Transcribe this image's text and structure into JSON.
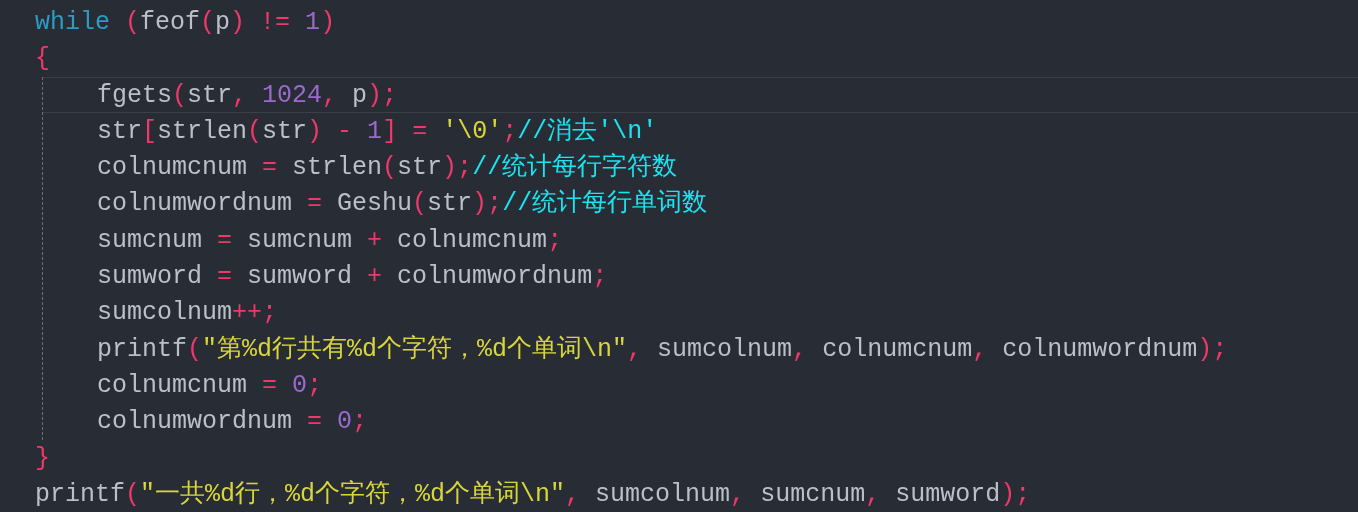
{
  "lines": [
    {
      "current": false,
      "tokens": [
        {
          "kind": "keyword",
          "text": "while"
        },
        {
          "kind": "operator",
          "text": " ("
        },
        {
          "kind": "identifier",
          "text": "feof"
        },
        {
          "kind": "operator",
          "text": "("
        },
        {
          "kind": "identifier",
          "text": "p"
        },
        {
          "kind": "operator",
          "text": ")"
        },
        {
          "kind": "operator",
          "text": " !="
        },
        {
          "kind": "number",
          "text": " 1"
        },
        {
          "kind": "operator",
          "text": ")"
        }
      ]
    },
    {
      "current": false,
      "tokens": [
        {
          "kind": "operator",
          "text": "{"
        }
      ],
      "children": [
        {
          "current": true,
          "tokens": [
            {
              "kind": "identifier",
              "text": "fgets"
            },
            {
              "kind": "operator",
              "text": "("
            },
            {
              "kind": "identifier",
              "text": "str"
            },
            {
              "kind": "operator",
              "text": ","
            },
            {
              "kind": "number",
              "text": " 1024"
            },
            {
              "kind": "operator",
              "text": ","
            },
            {
              "kind": "identifier",
              "text": " p"
            },
            {
              "kind": "operator",
              "text": ");"
            }
          ]
        },
        {
          "current": false,
          "tokens": [
            {
              "kind": "identifier",
              "text": "str"
            },
            {
              "kind": "operator",
              "text": "["
            },
            {
              "kind": "identifier",
              "text": "strlen"
            },
            {
              "kind": "operator",
              "text": "("
            },
            {
              "kind": "identifier",
              "text": "str"
            },
            {
              "kind": "operator",
              "text": ")"
            },
            {
              "kind": "operator",
              "text": " -"
            },
            {
              "kind": "number",
              "text": " 1"
            },
            {
              "kind": "operator",
              "text": "]"
            },
            {
              "kind": "operator",
              "text": " ="
            },
            {
              "kind": "string",
              "text": " '\\0'"
            },
            {
              "kind": "operator",
              "text": ";"
            },
            {
              "kind": "comment",
              "text": "//消去'\\n'"
            }
          ]
        },
        {
          "current": false,
          "tokens": [
            {
              "kind": "identifier",
              "text": "colnumcnum"
            },
            {
              "kind": "operator",
              "text": " ="
            },
            {
              "kind": "identifier",
              "text": " strlen"
            },
            {
              "kind": "operator",
              "text": "("
            },
            {
              "kind": "identifier",
              "text": "str"
            },
            {
              "kind": "operator",
              "text": ");"
            },
            {
              "kind": "comment",
              "text": "//统计每行字符数"
            }
          ]
        },
        {
          "current": false,
          "tokens": [
            {
              "kind": "identifier",
              "text": "colnumwordnum"
            },
            {
              "kind": "operator",
              "text": " ="
            },
            {
              "kind": "identifier",
              "text": " Geshu"
            },
            {
              "kind": "operator",
              "text": "("
            },
            {
              "kind": "identifier",
              "text": "str"
            },
            {
              "kind": "operator",
              "text": ");"
            },
            {
              "kind": "comment",
              "text": "//统计每行单词数"
            }
          ]
        },
        {
          "current": false,
          "tokens": [
            {
              "kind": "identifier",
              "text": "sumcnum"
            },
            {
              "kind": "operator",
              "text": " ="
            },
            {
              "kind": "identifier",
              "text": " sumcnum"
            },
            {
              "kind": "operator",
              "text": " +"
            },
            {
              "kind": "identifier",
              "text": " colnumcnum"
            },
            {
              "kind": "operator",
              "text": ";"
            }
          ]
        },
        {
          "current": false,
          "tokens": [
            {
              "kind": "identifier",
              "text": "sumword"
            },
            {
              "kind": "operator",
              "text": " ="
            },
            {
              "kind": "identifier",
              "text": " sumword"
            },
            {
              "kind": "operator",
              "text": " +"
            },
            {
              "kind": "identifier",
              "text": " colnumwordnum"
            },
            {
              "kind": "operator",
              "text": ";"
            }
          ]
        },
        {
          "current": false,
          "tokens": [
            {
              "kind": "identifier",
              "text": "sumcolnum"
            },
            {
              "kind": "operator",
              "text": "++;"
            }
          ]
        },
        {
          "current": false,
          "tokens": [
            {
              "kind": "identifier",
              "text": "printf"
            },
            {
              "kind": "operator",
              "text": "("
            },
            {
              "kind": "string",
              "text": "\"第%d行共有%d个字符，%d个单词\\n\""
            },
            {
              "kind": "operator",
              "text": ","
            },
            {
              "kind": "identifier",
              "text": " sumcolnum"
            },
            {
              "kind": "operator",
              "text": ","
            },
            {
              "kind": "identifier",
              "text": " colnumcnum"
            },
            {
              "kind": "operator",
              "text": ","
            },
            {
              "kind": "identifier",
              "text": " colnumwordnum"
            },
            {
              "kind": "operator",
              "text": ");"
            }
          ]
        },
        {
          "current": false,
          "tokens": [
            {
              "kind": "identifier",
              "text": "colnumcnum"
            },
            {
              "kind": "operator",
              "text": " ="
            },
            {
              "kind": "number",
              "text": " 0"
            },
            {
              "kind": "operator",
              "text": ";"
            }
          ]
        },
        {
          "current": false,
          "tokens": [
            {
              "kind": "identifier",
              "text": "colnumwordnum"
            },
            {
              "kind": "operator",
              "text": " ="
            },
            {
              "kind": "number",
              "text": " 0"
            },
            {
              "kind": "operator",
              "text": ";"
            }
          ]
        }
      ]
    },
    {
      "current": false,
      "tokens": [
        {
          "kind": "operator",
          "text": "}"
        }
      ]
    },
    {
      "current": false,
      "tokens": [
        {
          "kind": "identifier",
          "text": "printf"
        },
        {
          "kind": "operator",
          "text": "("
        },
        {
          "kind": "string",
          "text": "\"一共%d行，%d个字符，%d个单词\\n\""
        },
        {
          "kind": "operator",
          "text": ","
        },
        {
          "kind": "identifier",
          "text": " sumcolnum"
        },
        {
          "kind": "operator",
          "text": ","
        },
        {
          "kind": "identifier",
          "text": " sumcnum"
        },
        {
          "kind": "operator",
          "text": ","
        },
        {
          "kind": "identifier",
          "text": " sumword"
        },
        {
          "kind": "operator",
          "text": ");"
        }
      ]
    }
  ]
}
